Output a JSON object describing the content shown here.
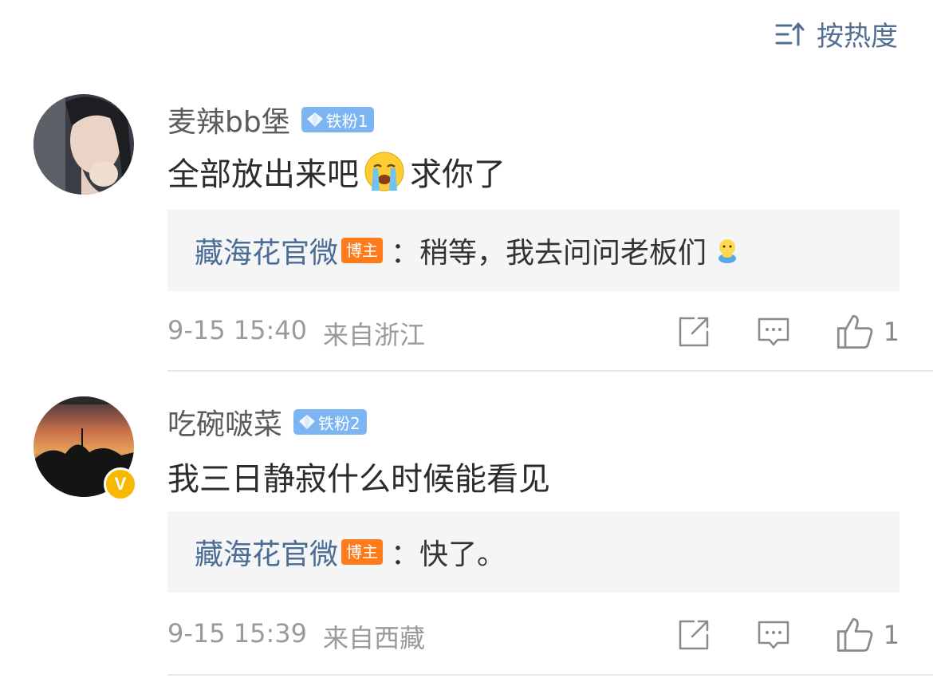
{
  "sort": {
    "label": "按热度",
    "icon": "sort-icon"
  },
  "comments": [
    {
      "username": "麦辣bb堡",
      "fan_badge": "铁粉1",
      "text_before": "全部放出来吧",
      "emoji": "crying-face-emoji",
      "text_after": "求你了",
      "reply": {
        "author": "藏海花官微",
        "author_badge": "博主",
        "text": "：稍等，我去问问老板们",
        "emoji": "hugging-doll-emoji"
      },
      "date": "9-15 15:40",
      "location": "来自浙江",
      "likes": "1"
    },
    {
      "username": "吃碗啵菜",
      "fan_badge": "铁粉2",
      "text": "我三日静寂什么时候能看见",
      "verified": true,
      "reply": {
        "author": "藏海花官微",
        "author_badge": "博主",
        "text": "：快了。"
      },
      "date": "9-15 15:39",
      "location": "来自西藏",
      "likes": "1"
    }
  ],
  "colors": {
    "link": "#4a6d98",
    "fan_badge": "#7cb5f2",
    "host_badge": "#ff7a1a",
    "verified": "#f8b800",
    "reply_bg": "#f5f5f5"
  }
}
